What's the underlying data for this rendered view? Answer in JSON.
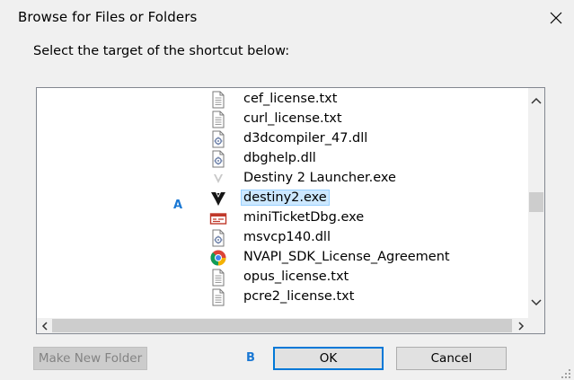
{
  "dialog": {
    "title": "Browse for Files or Folders",
    "prompt": "Select the target of the shortcut below:"
  },
  "markers": {
    "a": "A",
    "b": "B"
  },
  "items": [
    {
      "label": "cef_license.txt",
      "icon": "text-file-icon"
    },
    {
      "label": "curl_license.txt",
      "icon": "text-file-icon"
    },
    {
      "label": "d3dcompiler_47.dll",
      "icon": "dll-file-icon"
    },
    {
      "label": "dbghelp.dll",
      "icon": "dll-file-icon"
    },
    {
      "label": "Destiny 2 Launcher.exe",
      "icon": "destiny-launcher-icon"
    },
    {
      "label": "destiny2.exe",
      "icon": "destiny-icon",
      "selected": true
    },
    {
      "label": "miniTicketDbg.exe",
      "icon": "exe-app-icon"
    },
    {
      "label": "msvcp140.dll",
      "icon": "dll-file-icon"
    },
    {
      "label": "NVAPI_SDK_License_Agreement",
      "icon": "chrome-icon"
    },
    {
      "label": "opus_license.txt",
      "icon": "text-file-icon"
    },
    {
      "label": "pcre2_license.txt",
      "icon": "text-file-icon"
    }
  ],
  "buttons": {
    "new_folder": "Make New Folder",
    "ok": "OK",
    "cancel": "Cancel"
  },
  "colors": {
    "selection": "#cce8ff",
    "marker": "#1a78d4",
    "focus_border": "#0078d7"
  }
}
